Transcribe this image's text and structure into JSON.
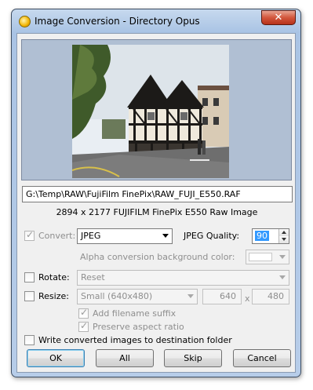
{
  "window": {
    "title": "Image Conversion - Directory Opus",
    "close_label": "✕"
  },
  "file": {
    "path": "G:\\Temp\\RAW\\FujiFilm FinePix\\RAW_FUJI_E550.RAF",
    "info": "2894 x 2177 FUJIFILM FinePix E550 Raw Image"
  },
  "convert": {
    "label": "Convert:",
    "checked": true,
    "format": "JPEG",
    "quality_label": "JPEG Quality:",
    "quality_value": "90",
    "alpha_label": "Alpha conversion background color:"
  },
  "rotate": {
    "label": "Rotate:",
    "checked": false,
    "value": "Reset"
  },
  "resize": {
    "label": "Resize:",
    "checked": false,
    "preset": "Small (640x480)",
    "width": "640",
    "times": "x",
    "height": "480",
    "add_suffix_label": "Add filename suffix",
    "add_suffix_checked": true,
    "preserve_label": "Preserve aspect ratio",
    "preserve_checked": true
  },
  "write_dest": {
    "label": "Write converted images to destination folder",
    "checked": false
  },
  "buttons": {
    "ok": "OK",
    "all": "All",
    "skip": "Skip",
    "cancel": "Cancel"
  },
  "colors": {
    "preview_bg": "#b0bfd3",
    "selection": "#3399ff"
  }
}
